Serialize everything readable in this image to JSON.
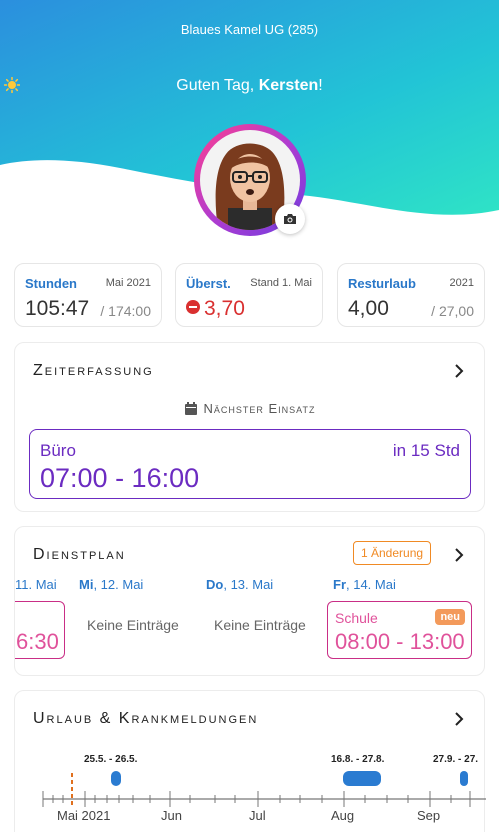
{
  "header": {
    "company": "Blaues Kamel UG (285)",
    "greeting_prefix": "Guten Tag, ",
    "user_name": "Kersten",
    "greeting_suffix": "!",
    "sun_icon": "sun-icon",
    "gradient_colors": [
      "#2b8fde",
      "#21c9d3",
      "#2fe0c8"
    ]
  },
  "stats": [
    {
      "label": "Stunden",
      "sub": "Mai 2021",
      "value": "105:47",
      "total": "/ 174:00"
    },
    {
      "label": "Überst.",
      "sub": "Stand 1. Mai",
      "value": "3,70",
      "total": ""
    },
    {
      "label": "Resturlaub",
      "sub": "2021",
      "value": "4,00",
      "total": "/ 27,00"
    }
  ],
  "zeiterfassung": {
    "title": "Zeiterfassung",
    "next_label": "Nächster Einsatz",
    "place": "Büro",
    "in_time": "in 15 Std",
    "time": "07:00 - 16:00",
    "accent": "#6b2bc1"
  },
  "dienstplan": {
    "title": "Dienstplan",
    "badge": "1 Änderung",
    "days": [
      {
        "weekday": "",
        "date": "11. Mai"
      },
      {
        "weekday": "Mi",
        "date": ", 12. Mai"
      },
      {
        "weekday": "Do",
        "date": ", 13. Mai"
      },
      {
        "weekday": "Fr",
        "date": ", 14. Mai"
      }
    ],
    "first_time_partial": "6:30",
    "empty_label_1": "Keine Einträge",
    "empty_label_2": "Keine Einträge",
    "entry": {
      "subject": "Schule",
      "tag": "neu",
      "time": "08:00 - 13:00"
    }
  },
  "urlaub": {
    "title": "Urlaub & Krankmeldungen",
    "periods": [
      "25.5. - 26.5.",
      "16.8. - 27.8.",
      "27.9. - 27."
    ],
    "months": [
      "Mai 2021",
      "Jun",
      "Jul",
      "Aug",
      "Sep"
    ],
    "bar_color": "#2a7bd1",
    "today_color": "#e0701e"
  }
}
